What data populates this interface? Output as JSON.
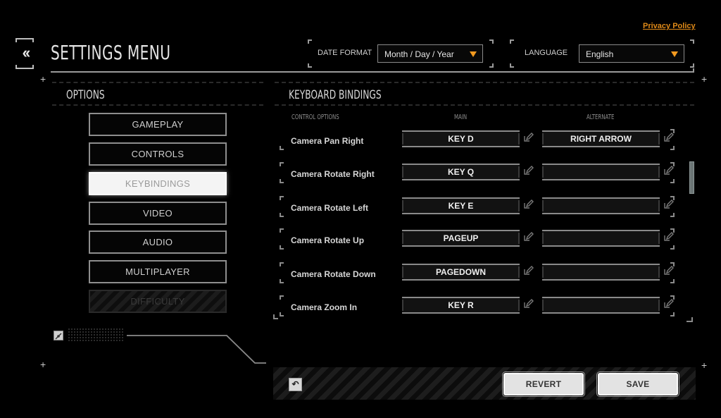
{
  "header": {
    "title": "SETTINGS MENU",
    "back_icon": "double-chevron-left-icon",
    "privacy_link": "Privacy Policy",
    "date_format": {
      "label": "DATE FORMAT",
      "value": "Month / Day / Year"
    },
    "language": {
      "label": "LANGUAGE",
      "value": "English"
    }
  },
  "colors": {
    "accent": "#f39a1f",
    "link": "#e08a18",
    "background": "#000000"
  },
  "options": {
    "heading": "OPTIONS",
    "items": [
      {
        "label": "GAMEPLAY",
        "state": "normal"
      },
      {
        "label": "CONTROLS",
        "state": "normal"
      },
      {
        "label": "KEYBINDINGS",
        "state": "active"
      },
      {
        "label": "VIDEO",
        "state": "normal"
      },
      {
        "label": "AUDIO",
        "state": "normal"
      },
      {
        "label": "MULTIPLAYER",
        "state": "normal"
      },
      {
        "label": "DIFFICULTY",
        "state": "disabled"
      }
    ]
  },
  "bindings": {
    "heading": "KEYBOARD BINDINGS",
    "columns": {
      "control": "CONTROL OPTIONS",
      "main": "MAIN",
      "alternate": "ALTERNATE"
    },
    "rows": [
      {
        "action": "Camera Pan Right",
        "main": "KEY D",
        "alternate": "RIGHT ARROW"
      },
      {
        "action": "Camera Rotate Right",
        "main": "KEY Q",
        "alternate": ""
      },
      {
        "action": "Camera Rotate Left",
        "main": "KEY E",
        "alternate": ""
      },
      {
        "action": "Camera Rotate Up",
        "main": "PAGEUP",
        "alternate": ""
      },
      {
        "action": "Camera Rotate Down",
        "main": "PAGEDOWN",
        "alternate": ""
      },
      {
        "action": "Camera Zoom In",
        "main": "KEY R",
        "alternate": ""
      }
    ]
  },
  "footer": {
    "revert_label": "REVERT",
    "save_label": "SAVE",
    "reset_icon": "undo-icon"
  }
}
